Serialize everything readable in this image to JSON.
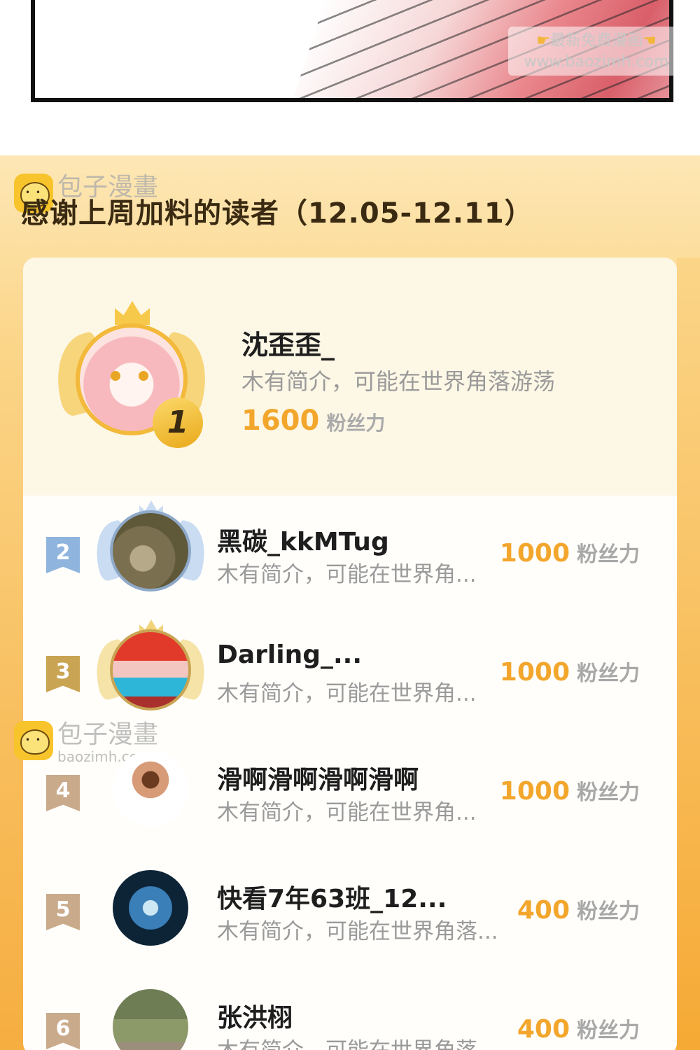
{
  "watermark_top": {
    "line1": "最新免费漫画",
    "line2": "www.baozimh.com"
  },
  "watermark_logo": {
    "name": "包子漫畫",
    "domain": "baozimh.com"
  },
  "board": {
    "title": "感谢上周加料的读者（12.05-12.11）"
  },
  "first_place": {
    "rank": "1",
    "name": "沈歪歪_",
    "bio": "木有简介，可能在世界角落游荡",
    "power": "1600",
    "unit": "粉丝力"
  },
  "ranks": [
    {
      "rank": "2",
      "name": "黑碳_kkMTug",
      "bio": "木有简介，可能在世界角...",
      "power": "1000",
      "unit": "粉丝力"
    },
    {
      "rank": "3",
      "name": "Darling_...",
      "bio": "木有简介，可能在世界角...",
      "power": "1000",
      "unit": "粉丝力"
    },
    {
      "rank": "4",
      "name": "滑啊滑啊滑啊滑啊",
      "bio": "木有简介，可能在世界角...",
      "power": "1000",
      "unit": "粉丝力"
    },
    {
      "rank": "5",
      "name": "快看7年63班_12...",
      "bio": "木有简介，可能在世界角落...",
      "power": "400",
      "unit": "粉丝力"
    },
    {
      "rank": "6",
      "name": "张洪栩",
      "bio": "木有简介，可能在世界角落...",
      "power": "400",
      "unit": "粉丝力"
    }
  ],
  "colors": {
    "gold": "#f3a62c",
    "silver": "#8fb4de",
    "bronze": "#c9a453",
    "plain_rank": "#c9aa8b"
  }
}
